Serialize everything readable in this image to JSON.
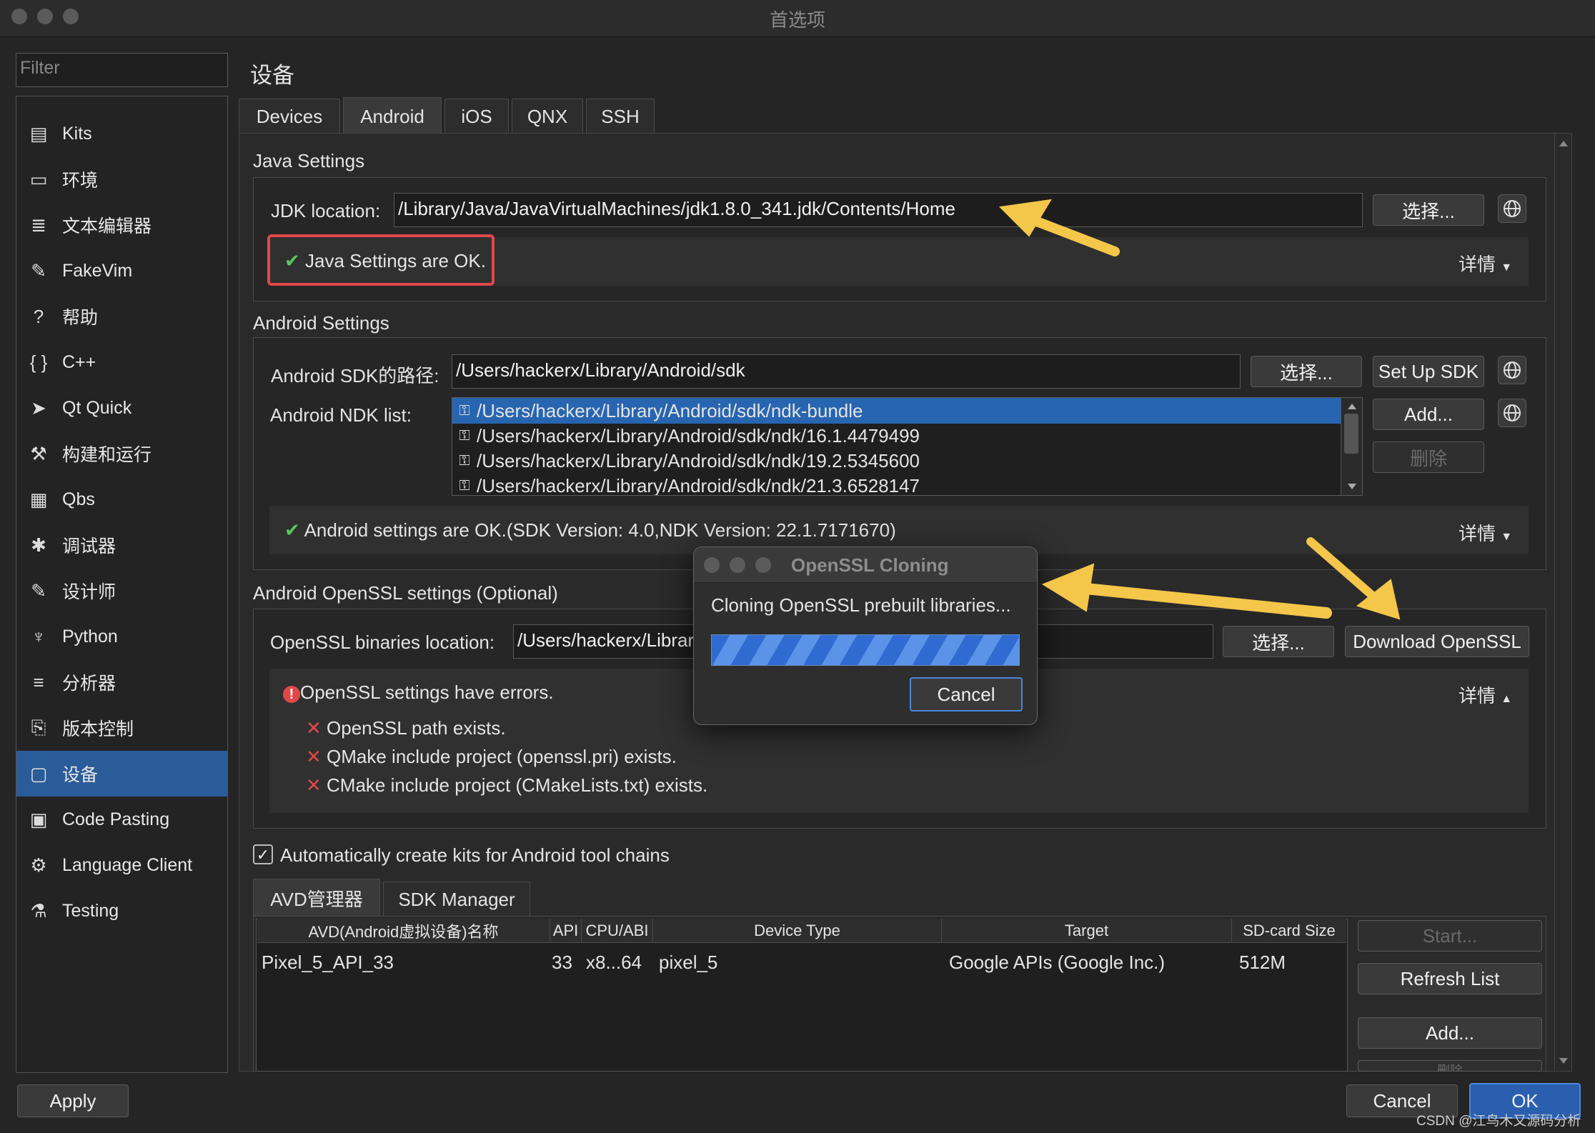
{
  "window": {
    "title": "首选项"
  },
  "sidebar": {
    "filter_placeholder": "Filter",
    "items": [
      {
        "label": "Kits",
        "icon": "kits-icon"
      },
      {
        "label": "环境",
        "icon": "monitor-icon"
      },
      {
        "label": "文本编辑器",
        "icon": "text-editor-icon"
      },
      {
        "label": "FakeVim",
        "icon": "fakevim-icon"
      },
      {
        "label": "帮助",
        "icon": "help-icon"
      },
      {
        "label": "C++",
        "icon": "braces-icon"
      },
      {
        "label": "Qt Quick",
        "icon": "qtquick-icon"
      },
      {
        "label": "构建和运行",
        "icon": "hammer-icon"
      },
      {
        "label": "Qbs",
        "icon": "qbs-icon"
      },
      {
        "label": "调试器",
        "icon": "bug-icon"
      },
      {
        "label": "设计师",
        "icon": "pencil-icon"
      },
      {
        "label": "Python",
        "icon": "python-icon"
      },
      {
        "label": "分析器",
        "icon": "analyzer-icon"
      },
      {
        "label": "版本控制",
        "icon": "version-control-icon"
      },
      {
        "label": "设备",
        "icon": "device-icon",
        "selected": true
      },
      {
        "label": "Code Pasting",
        "icon": "clipboard-icon"
      },
      {
        "label": "Language Client",
        "icon": "language-client-icon"
      },
      {
        "label": "Testing",
        "icon": "flask-icon"
      }
    ]
  },
  "page": {
    "title": "设备"
  },
  "tabs": [
    "Devices",
    "Android",
    "iOS",
    "QNX",
    "SSH"
  ],
  "java": {
    "section": "Java Settings",
    "jdk_label": "JDK location:",
    "jdk_value": "/Library/Java/JavaVirtualMachines/jdk1.8.0_341.jdk/Contents/Home",
    "choose": "选择...",
    "status": "Java Settings are OK.",
    "details": "详情"
  },
  "android": {
    "section": "Android Settings",
    "sdk_label": "Android SDK的路径:",
    "sdk_value": "/Users/hackerx/Library/Android/sdk",
    "choose": "选择...",
    "setup_sdk": "Set Up SDK",
    "ndk_label": "Android NDK list:",
    "ndk_items": [
      "/Users/hackerx/Library/Android/sdk/ndk-bundle",
      "/Users/hackerx/Library/Android/sdk/ndk/16.1.4479499",
      "/Users/hackerx/Library/Android/sdk/ndk/19.2.5345600",
      "/Users/hackerx/Library/Android/sdk/ndk/21.3.6528147"
    ],
    "add": "Add...",
    "remove": "删除",
    "status": "Android settings are OK.(SDK Version: 4.0,NDK Version: 22.1.7171670)",
    "details": "详情"
  },
  "openssl": {
    "section": "Android OpenSSL settings (Optional)",
    "location_label": "OpenSSL binaries location:",
    "location_value": "/Users/hackerx/Library/Android/sdk/android_openssl",
    "choose": "选择...",
    "download": "Download OpenSSL",
    "status": "OpenSSL settings have errors.",
    "details": "详情",
    "errors": [
      "OpenSSL path exists.",
      "QMake include project (openssl.pri) exists.",
      "CMake include project (CMakeLists.txt) exists."
    ]
  },
  "auto_kits": {
    "label": "Automatically create kits for Android tool chains",
    "checked": true
  },
  "lower_tabs": [
    "AVD管理器",
    "SDK Manager"
  ],
  "avd_table": {
    "columns": [
      "AVD(Android虚拟设备)名称",
      "API",
      "CPU/ABI",
      "Device Type",
      "Target",
      "SD-card Size"
    ],
    "rows": [
      [
        "Pixel_5_API_33",
        "33",
        "x8...64",
        "pixel_5",
        "Google APIs (Google Inc.)",
        "512M"
      ]
    ]
  },
  "avd_buttons": {
    "start": "Start...",
    "refresh": "Refresh List",
    "add": "Add...",
    "remove": "删除"
  },
  "dialog": {
    "title": "OpenSSL Cloning",
    "message": "Cloning OpenSSL prebuilt libraries...",
    "cancel": "Cancel"
  },
  "footer": {
    "apply": "Apply",
    "cancel": "Cancel",
    "ok": "OK"
  },
  "watermark": "CSDN @江鸟木又源码分析",
  "colors": {
    "accent": "#2a5c9a",
    "selection": "#2765b0",
    "ok": "#5bc35b",
    "error": "#e04848",
    "highlight_box": "#e04848",
    "arrow": "#f4c64a"
  }
}
